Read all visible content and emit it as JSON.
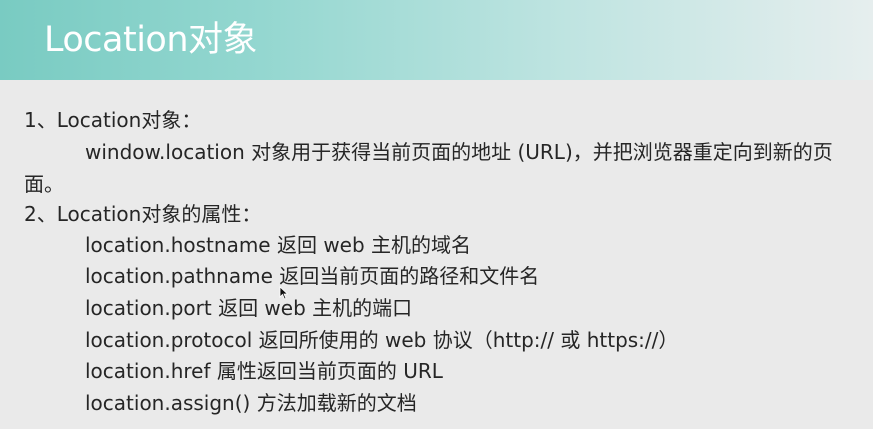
{
  "title": "Location对象",
  "section1": {
    "heading": "1、Location对象：",
    "desc_line1": "window.location 对象用于获得当前页面的地址 (URL)，并把浏览器重定向到新的页",
    "desc_line2": "面。"
  },
  "section2": {
    "heading": "2、Location对象的属性：",
    "items": [
      "location.hostname 返回 web 主机的域名",
      "location.pathname 返回当前页面的路径和文件名",
      "location.port 返回 web 主机的端口",
      "location.protocol 返回所使用的 web 协议（http:// 或 https://）",
      "location.href 属性返回当前页面的 URL",
      "location.assign() 方法加载新的文档"
    ]
  },
  "icons": {
    "cursor": "mouse-pointer-icon"
  }
}
